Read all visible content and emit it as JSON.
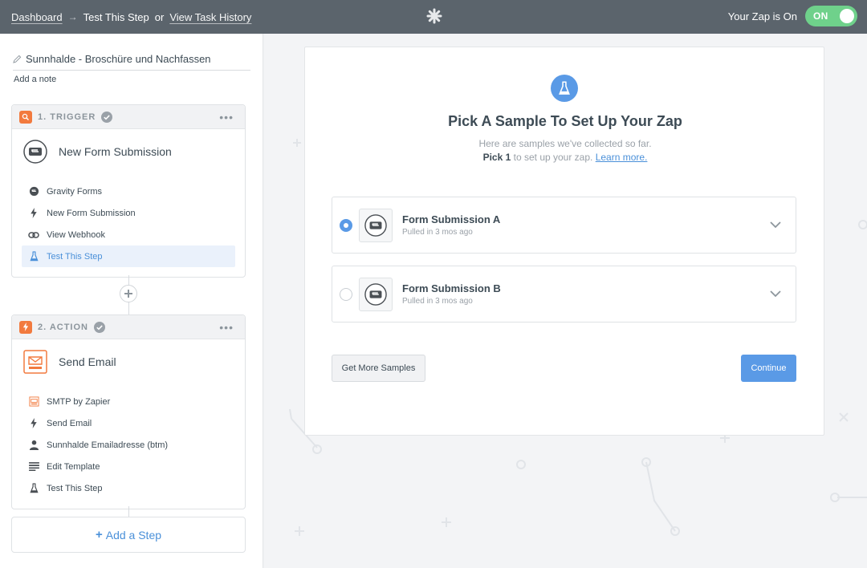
{
  "topbar": {
    "breadcrumb_dashboard": "Dashboard",
    "breadcrumb_arrow": "→",
    "breadcrumb_current": "Test This Step",
    "breadcrumb_or": "or",
    "breadcrumb_history": "View Task History",
    "zap_status_label": "Your Zap is On",
    "toggle_label": "ON",
    "logo_icon": "zapier-asterisk-icon"
  },
  "sidebar": {
    "zap_name": "Sunnhalde - Broschüre und Nachfassen",
    "add_note": "Add a note",
    "trigger": {
      "header": "1. TRIGGER",
      "dots": "•••",
      "app_title": "New Form Submission",
      "items": [
        {
          "label": "Gravity Forms",
          "icon": "gravity-forms-icon"
        },
        {
          "label": "New Form Submission",
          "icon": "bolt-icon"
        },
        {
          "label": "View Webhook",
          "icon": "link-icon"
        },
        {
          "label": "Test This Step",
          "icon": "flask-icon"
        }
      ]
    },
    "action": {
      "header": "2. ACTION",
      "dots": "•••",
      "app_title": "Send Email",
      "items": [
        {
          "label": "SMTP by Zapier",
          "icon": "smtp-icon"
        },
        {
          "label": "Send Email",
          "icon": "bolt-icon"
        },
        {
          "label": "Sunnhalde Emailadresse (btm)",
          "icon": "user-icon"
        },
        {
          "label": "Edit Template",
          "icon": "lines-icon"
        },
        {
          "label": "Test This Step",
          "icon": "flask-icon"
        }
      ]
    },
    "add_step_plus": "+",
    "add_step_label": "Add a Step"
  },
  "main": {
    "title": "Pick A Sample To Set Up Your Zap",
    "subtitle_line1": "Here are samples we've collected so far.",
    "subtitle_pick": "Pick 1",
    "subtitle_line2": " to set up your zap. ",
    "learn_more": "Learn more.",
    "samples": [
      {
        "name": "Form Submission A",
        "meta": "Pulled in 3 mos ago",
        "selected": true
      },
      {
        "name": "Form Submission B",
        "meta": "Pulled in 3 mos ago",
        "selected": false
      }
    ],
    "get_more": "Get More Samples",
    "continue": "Continue"
  },
  "colors": {
    "topbar": "#5b646c",
    "toggle_on": "#6fd18b",
    "accent": "#5a9ae6",
    "step_badge": "#f27a3e"
  }
}
